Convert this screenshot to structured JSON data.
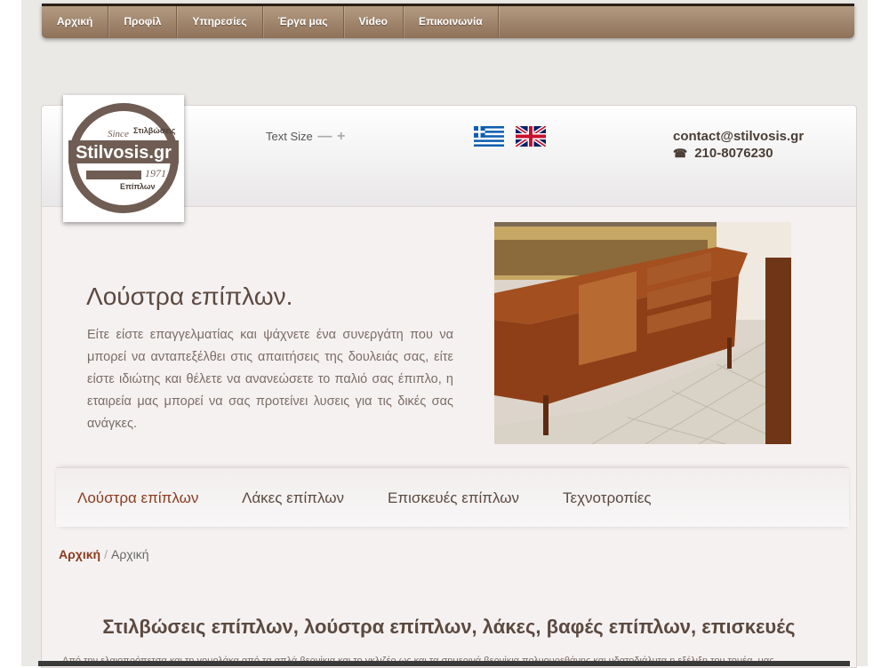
{
  "nav": {
    "items": [
      "Αρχική",
      "Προφίλ",
      "Υπηρεσίες",
      "Έργα μας",
      "Video",
      "Επικοινωνία"
    ]
  },
  "header": {
    "logo": {
      "top_text": "Στιλβώσεις",
      "since": "Since",
      "brand": "Stilvosis.gr",
      "year": "1971",
      "bottom_text": "Επίπλων"
    },
    "text_size": {
      "label": "Text Size",
      "decrease": "—",
      "increase": "+"
    },
    "flags": [
      "greek-flag-icon",
      "uk-flag-icon"
    ],
    "contact": {
      "email": "contact@stilvosis.gr",
      "phone": "210-8076230"
    }
  },
  "hero": {
    "title": "Λούστρα επίπλων.",
    "text": "Είτε είστε επαγγελματίας και ψάχνετε ένα συνεργάτη που να μπορεί να ανταπεξέλθει στις απαιτήσεις της δουλειάς σας, είτε είστε ιδιώτης και θέλετε να ανανεώσετε το παλιό σας έπιπλο, η εταιρεία μας μπορεί να σας προτείνει λυσεις για τις δικές σας ανάγκες."
  },
  "subtabs": {
    "items": [
      "Λούστρα επίπλων",
      "Λάκες επίπλων",
      "Επισκευές επίπλων",
      "Τεχνοτροπίες"
    ],
    "active": "Λούστρα επίπλων"
  },
  "breadcrumb": {
    "home": "Αρχική",
    "separator": "/",
    "current": "Αρχική"
  },
  "content": {
    "title": "Στιλβώσεις επίπλων, λούστρα επίπλων, λάκες, βαφές επίπλων, επισκευές",
    "text": "Από την ελαιοπρόπετσα και τη γομολάκα από τα απλά βερνίκια και το γκλιζέρ ως και τα σημερινά βερνίκια πολυουρεθάνης και υδατοδιάλυτα η εξέλιξη του τομέα, μας"
  },
  "colors": {
    "accent": "#8a3c1e",
    "nav": "#a08268",
    "text": "#5b4a40"
  }
}
